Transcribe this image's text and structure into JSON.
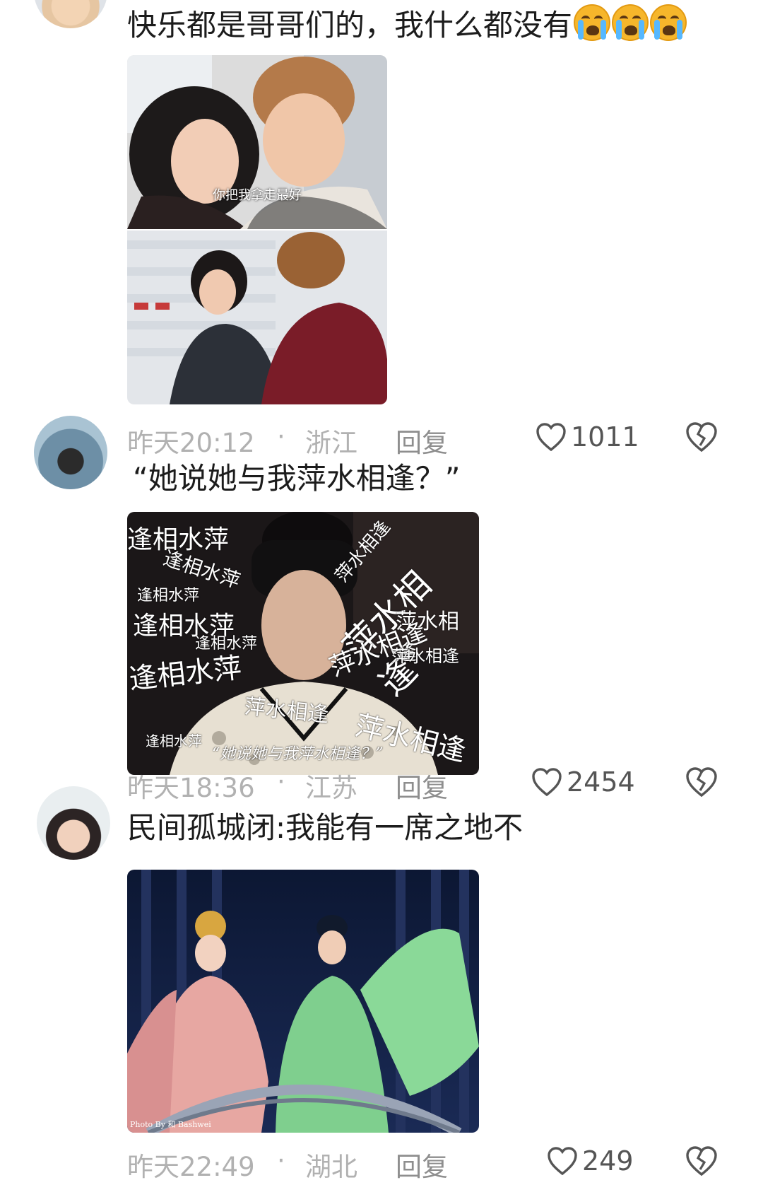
{
  "comments": [
    {
      "text": "快乐都是哥哥们的，我什么都没有",
      "emoji_count": 3,
      "emoji_icon": "crying-face-emoji",
      "image_caption": "你把我拿走最好",
      "time": "昨天20:12",
      "dot": "·",
      "location": "浙江",
      "reply": "回复",
      "likes": "1011"
    },
    {
      "text": "“她说她与我萍水相逢？”",
      "image_caption": "“她说她与我萍水相逢？”",
      "overlay_words": [
        "逢相水萍",
        "逢相水萍",
        "逢相水萍",
        "逢相水萍",
        "逢相水萍",
        "逢相水萍",
        "萍水相逢",
        "萍水相逢",
        "萍水相逢",
        "萍水相逢",
        "萍水相逢",
        "萍水相逢",
        "逢相水萍",
        "萍水相逢"
      ],
      "time": "昨天18:36",
      "dot": "·",
      "location": "江苏",
      "reply": "回复",
      "likes": "2454"
    },
    {
      "text": "民间孤城闭:我能有一席之地不",
      "image_watermark": "Photo By 和 Bashwei",
      "time": "昨天22:49",
      "dot": "·",
      "location": "湖北",
      "reply": "回复",
      "likes": "249"
    }
  ],
  "icons": {
    "like": "heart-outline-icon",
    "dislike": "broken-heart-icon"
  },
  "colors": {
    "meta": "#b1b1b1",
    "text": "#1c1c1c",
    "icon": "#555555"
  }
}
